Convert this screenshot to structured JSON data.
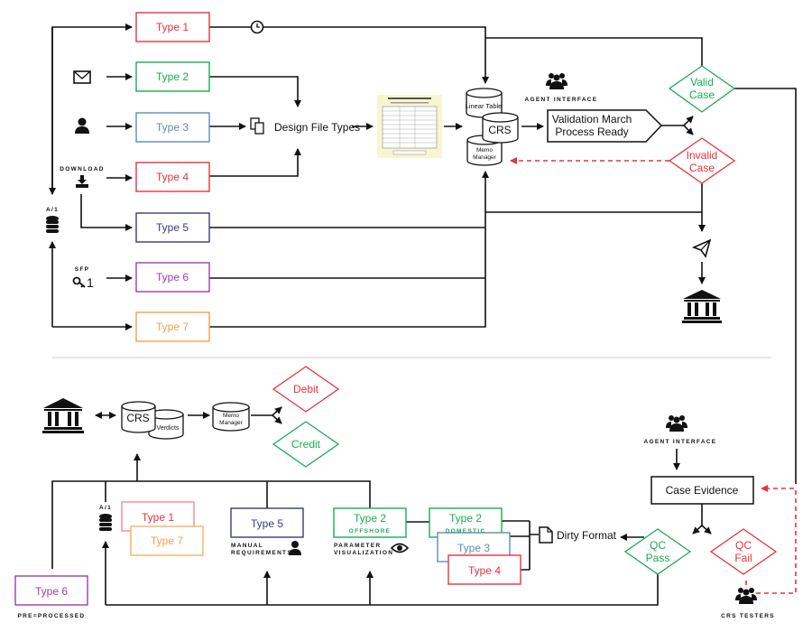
{
  "colors": {
    "red": "#e8323c",
    "green": "#1aaa55",
    "blue": "#5b8db8",
    "navy": "#3a3a7a",
    "purple": "#9b3fa6",
    "orange": "#f5a04a",
    "ink": "#111111",
    "divider": "#cccccc",
    "doc_bg": "#f8f6d0"
  },
  "top": {
    "types": [
      "Type 1",
      "Type 2",
      "Type 3",
      "Type 4",
      "Type 5",
      "Type 6",
      "Type 7"
    ],
    "download_label": "DOWNLOAD",
    "a1_label": "A/1",
    "sfp_label": "SFP",
    "key_suffix": "1",
    "design_file_types": "Design File Types",
    "linear_table": "Linear Table",
    "crs": "CRS",
    "memo": "Memo",
    "manager": "Manager",
    "agent_interface": "AGENT INTERFACE",
    "validation_line1": "Validation March",
    "validation_line2": "Process Ready",
    "valid": [
      "Valid",
      "Case"
    ],
    "invalid": [
      "Invalid",
      "Case"
    ],
    "icons": [
      "envelope-icon",
      "user-icon",
      "download-icon",
      "database-icon",
      "key-icon",
      "clock-icon",
      "files-icon",
      "document-thumbnail",
      "group-icon",
      "paper-plane-icon",
      "bank-icon"
    ]
  },
  "bottom": {
    "crs": "CRS",
    "verdicts": "Verdicts",
    "memo": "Memo",
    "manager": "Manager",
    "debit": "Debit",
    "credit": "Credit",
    "a1_label": "A/1",
    "type1": "Type 1",
    "type7": "Type 7",
    "type5": "Type 5",
    "manual": [
      "MANUAL",
      "REQUIREMENTS"
    ],
    "type2_offshore": "Type 2",
    "offshore": "OFFSHORE",
    "param": [
      "PARAMETER",
      "VISUALIZATION"
    ],
    "type2_domestic": "Type 2",
    "domestic": "DOMESTIC",
    "type3": "Type 3",
    "type4": "Type 4",
    "dirty_format": "Dirty Format",
    "type6": "Type 6",
    "preprocessed": "PRE=PROCESSED",
    "agent_interface": "AGENT INTERFACE",
    "case_evidence": "Case Evidence",
    "qc_pass": [
      "QC",
      "Pass"
    ],
    "qc_fail": [
      "QC",
      "Fail"
    ],
    "crs_testers": "CRS TESTERS"
  }
}
